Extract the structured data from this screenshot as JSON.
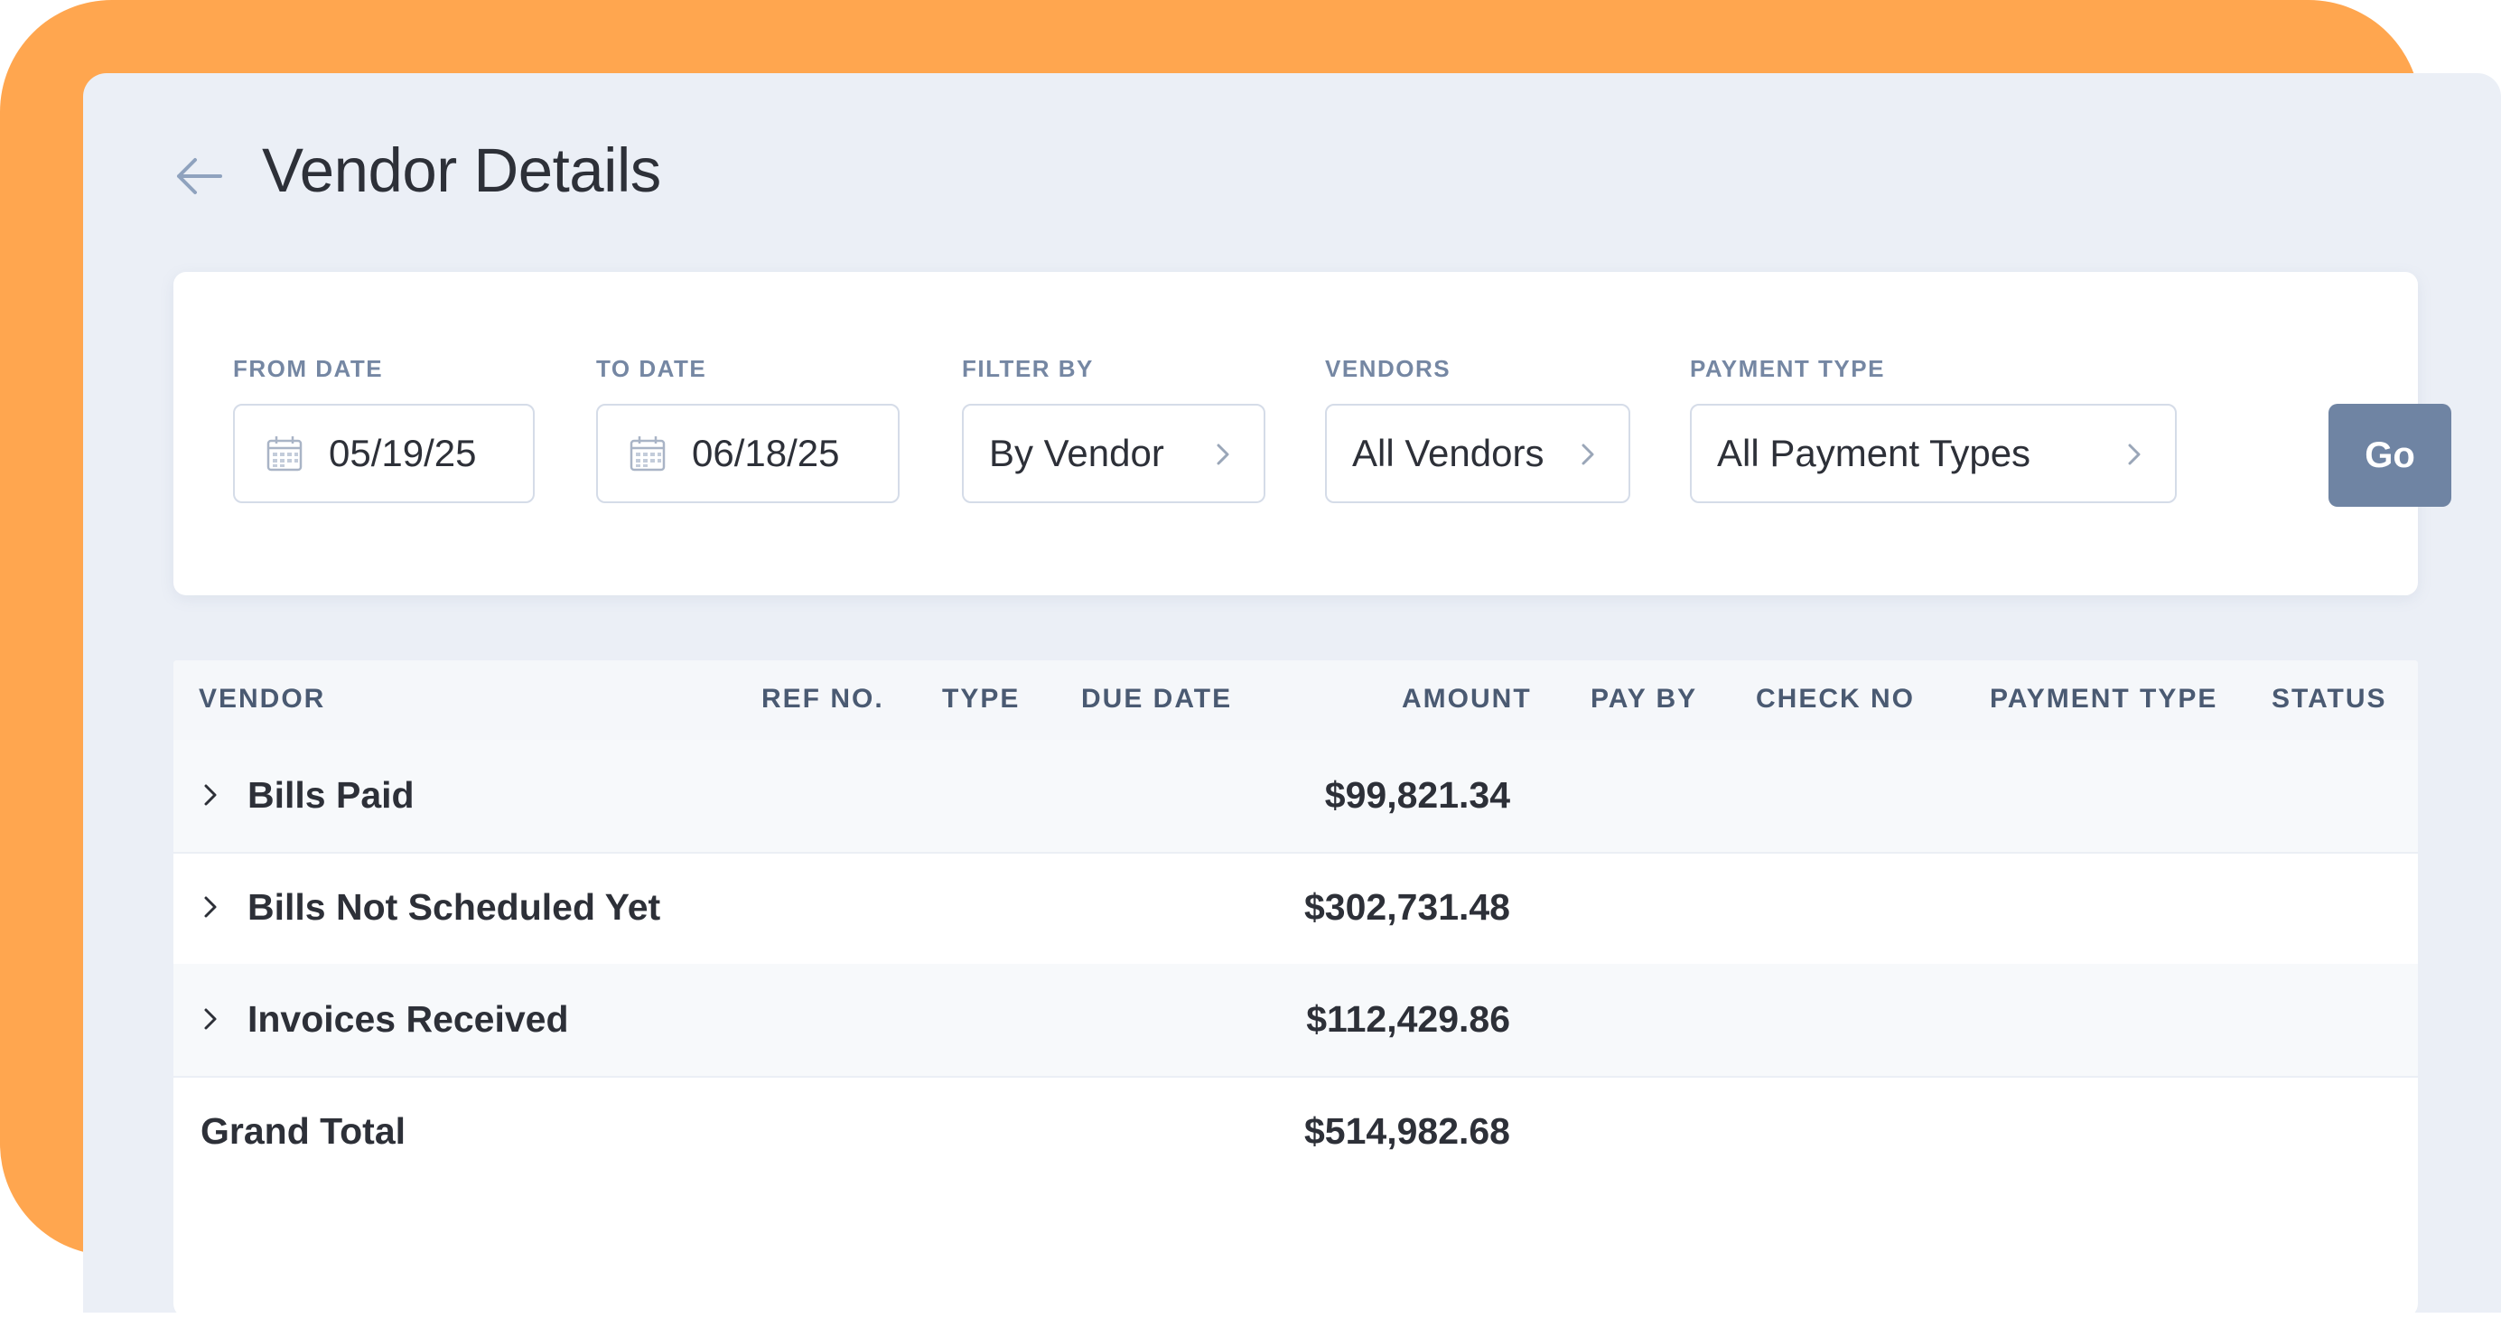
{
  "header": {
    "title": "Vendor Details"
  },
  "filters": {
    "from_date": {
      "label": "FROM DATE",
      "value": "05/19/25"
    },
    "to_date": {
      "label": "TO DATE",
      "value": "06/18/25"
    },
    "filter_by": {
      "label": "FILTER BY",
      "value": "By Vendor"
    },
    "vendors": {
      "label": "VENDORS",
      "value": "All Vendors"
    },
    "payment_type": {
      "label": "PAYMENT TYPE",
      "value": "All Payment Types"
    },
    "go_label": "Go"
  },
  "table": {
    "columns": [
      "VENDOR",
      "REF NO.",
      "TYPE",
      "DUE DATE",
      "AMOUNT",
      "PAY BY",
      "CHECK NO",
      "PAYMENT TYPE",
      "STATUS"
    ],
    "rows": [
      {
        "label": "Bills Paid",
        "amount": "$99,821.34"
      },
      {
        "label": "Bills Not Scheduled Yet",
        "amount": "$302,731.48"
      },
      {
        "label": "Invoices Received",
        "amount": "$112,429.86"
      }
    ],
    "grand_total": {
      "label": "Grand Total",
      "amount": "$514,982.68"
    }
  },
  "colors": {
    "accent_orange": "#FFA64F",
    "go_button": "#6F84A3",
    "panel_bg": "#EBEFF6",
    "label_color": "#7587A3"
  },
  "icons": {
    "back": "arrow-left-icon",
    "calendar": "calendar-icon",
    "chevron": "chevron-right-icon"
  }
}
